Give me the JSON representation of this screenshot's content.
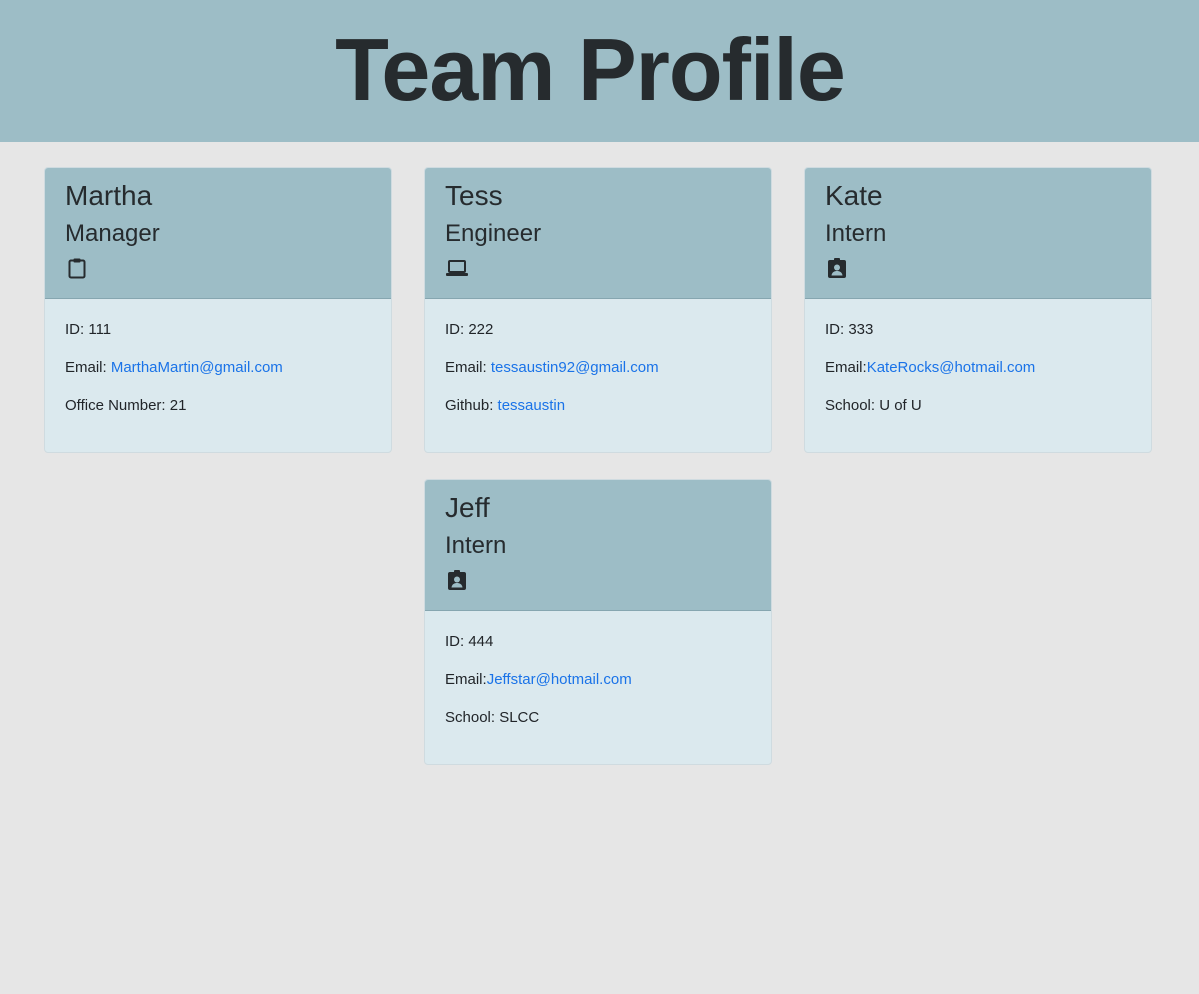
{
  "header": {
    "title": "Team Profile"
  },
  "colors": {
    "header_bg": "#9dbdc6",
    "card_body_bg": "#dbe9ee",
    "page_bg": "#e6e6e6",
    "link": "#1a73e8"
  },
  "cards": [
    {
      "name": "Martha",
      "role": "Manager",
      "icon": "clipboard-icon",
      "id_label": "ID: ",
      "id": "111",
      "email_label": "Email: ",
      "email": "MarthaMartin@gmail.com",
      "extra_label": "Office Number: ",
      "extra_value": "21"
    },
    {
      "name": "Tess",
      "role": "Engineer",
      "icon": "laptop-icon",
      "id_label": "ID: ",
      "id": "222",
      "email_label": "Email: ",
      "email": "tessaustin92@gmail.com",
      "extra_label": "Github: ",
      "extra_value": "tessaustin"
    },
    {
      "name": "Kate",
      "role": "Intern",
      "icon": "id-badge-icon",
      "id_label": "ID: ",
      "id": "333",
      "email_label": "Email:",
      "email": "KateRocks@hotmail.com",
      "extra_label": "School: ",
      "extra_value": "U of U"
    },
    {
      "name": "Jeff",
      "role": "Intern",
      "icon": "id-badge-icon",
      "id_label": "ID: ",
      "id": "444",
      "email_label": "Email:",
      "email": "Jeffstar@hotmail.com",
      "extra_label": "School: ",
      "extra_value": "SLCC"
    }
  ]
}
